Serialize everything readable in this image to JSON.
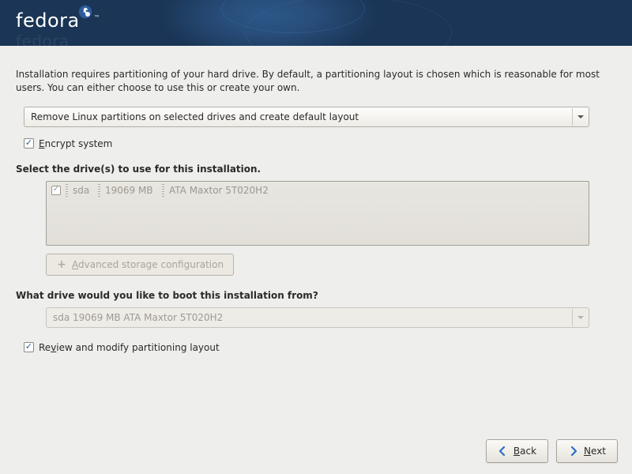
{
  "header": {
    "brand": "fedora",
    "brand_reflection": "fedora"
  },
  "intro_text": "Installation requires partitioning of your hard drive.  By default, a partitioning layout is chosen which is reasonable for most users.  You can either choose to use this or create your own.",
  "partition_scheme": {
    "selected": "Remove Linux partitions on selected drives and create default layout"
  },
  "encrypt": {
    "checked": true,
    "label_pre": "",
    "label_underline": "E",
    "label_post": "ncrypt system"
  },
  "drives_section_label": "Select the drive(s) to use for this installation.",
  "drives": [
    {
      "checked": true,
      "dev": "sda",
      "size": "19069 MB",
      "model": "ATA Maxtor 5T020H2"
    }
  ],
  "advanced_btn": {
    "label_underline": "A",
    "label_post": "dvanced storage configuration"
  },
  "boot_section_label": "What drive would you like to boot this installation from?",
  "boot_drive": {
    "selected": "sda     19069 MB ATA Maxtor 5T020H2"
  },
  "review": {
    "checked": true,
    "label_pre": "Re",
    "label_underline": "v",
    "label_post": "iew and modify partitioning layout"
  },
  "nav": {
    "back_underline": "B",
    "back_post": "ack",
    "next_underline": "N",
    "next_post": "ext"
  }
}
